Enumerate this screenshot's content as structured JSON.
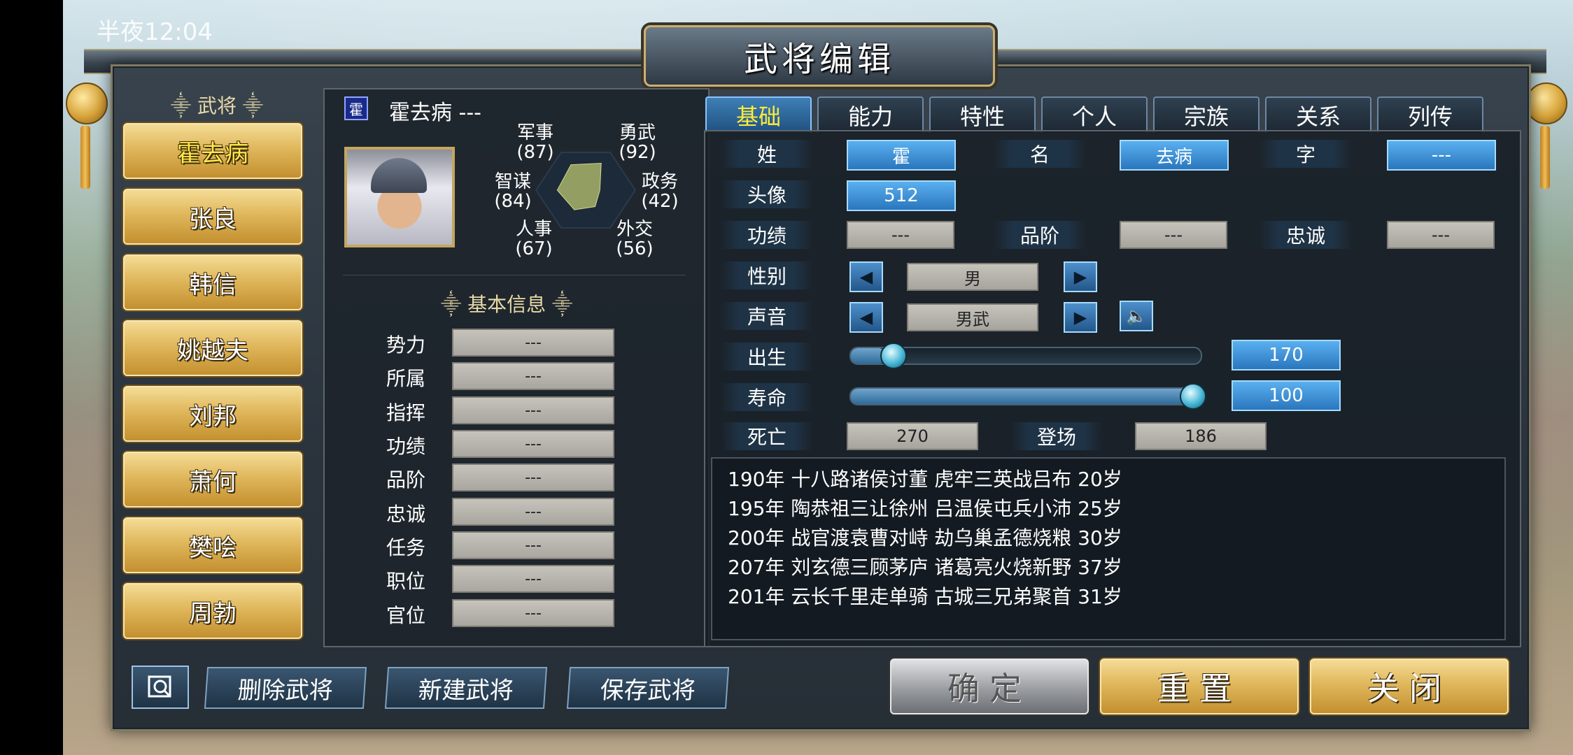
{
  "status": {
    "time": "半夜12:04"
  },
  "window": {
    "title": "武将编辑"
  },
  "sidebar": {
    "header": "武将",
    "items": [
      {
        "label": "霍去病"
      },
      {
        "label": "张良"
      },
      {
        "label": "韩信"
      },
      {
        "label": "姚越夫"
      },
      {
        "label": "刘邦"
      },
      {
        "label": "萧何"
      },
      {
        "label": "樊哙"
      },
      {
        "label": "周勃"
      }
    ]
  },
  "hero": {
    "badge": "霍",
    "name": "霍去病 ---",
    "stats": [
      {
        "label": "军事",
        "value": "(87)",
        "v": 87
      },
      {
        "label": "勇武",
        "value": "(92)",
        "v": 92
      },
      {
        "label": "政务",
        "value": "(42)",
        "v": 42
      },
      {
        "label": "外交",
        "value": "(56)",
        "v": 56
      },
      {
        "label": "人事",
        "value": "(67)",
        "v": 67
      },
      {
        "label": "智谋",
        "value": "(84)",
        "v": 84
      }
    ]
  },
  "basic_info": {
    "title": "基本信息",
    "rows": [
      {
        "label": "势力",
        "value": "---"
      },
      {
        "label": "所属",
        "value": "---"
      },
      {
        "label": "指挥",
        "value": "---"
      },
      {
        "label": "功绩",
        "value": "---"
      },
      {
        "label": "品阶",
        "value": "---"
      },
      {
        "label": "忠诚",
        "value": "---"
      },
      {
        "label": "任务",
        "value": "---"
      },
      {
        "label": "职位",
        "value": "---"
      },
      {
        "label": "官位",
        "value": "---"
      }
    ]
  },
  "tabs": [
    {
      "label": "基础"
    },
    {
      "label": "能力"
    },
    {
      "label": "特性"
    },
    {
      "label": "个人"
    },
    {
      "label": "宗族"
    },
    {
      "label": "关系"
    },
    {
      "label": "列传"
    }
  ],
  "form": {
    "surname_label": "姓",
    "surname": "霍",
    "given_label": "名",
    "given": "去病",
    "style_label": "字",
    "style": "---",
    "portrait_label": "头像",
    "portrait": "512",
    "merit_label": "功绩",
    "merit": "---",
    "rank_label": "品阶",
    "rank": "---",
    "loyalty_label": "忠诚",
    "loyalty": "---",
    "gender_label": "性别",
    "gender": "男",
    "voice_label": "声音",
    "voice": "男武",
    "birth_label": "出生",
    "birth": "170",
    "birth_fraction": 0.1,
    "lifespan_label": "寿命",
    "lifespan": "100",
    "lifespan_fraction": 1.0,
    "death_label": "死亡",
    "death": "270",
    "debut_label": "登场",
    "debut": "186"
  },
  "biography": [
    "190年 十八路诸侯讨董 虎牢三英战吕布 20岁",
    "195年 陶恭祖三让徐州 吕温侯屯兵小沛 25岁",
    "200年 战官渡袁曹对峙 劫乌巢孟德烧粮 30岁",
    "207年 刘玄德三顾茅庐 诸葛亮火烧新野 37岁",
    "201年 云长千里走单骑 古城三兄弟聚首 31岁"
  ],
  "toolbar": {
    "delete": "删除武将",
    "create": "新建武将",
    "save": "保存武将",
    "confirm": "确定",
    "reset": "重置",
    "close": "关闭"
  },
  "icons": [
    "search-icon",
    "speaker-icon",
    "arrow-left-icon",
    "arrow-right-icon"
  ]
}
